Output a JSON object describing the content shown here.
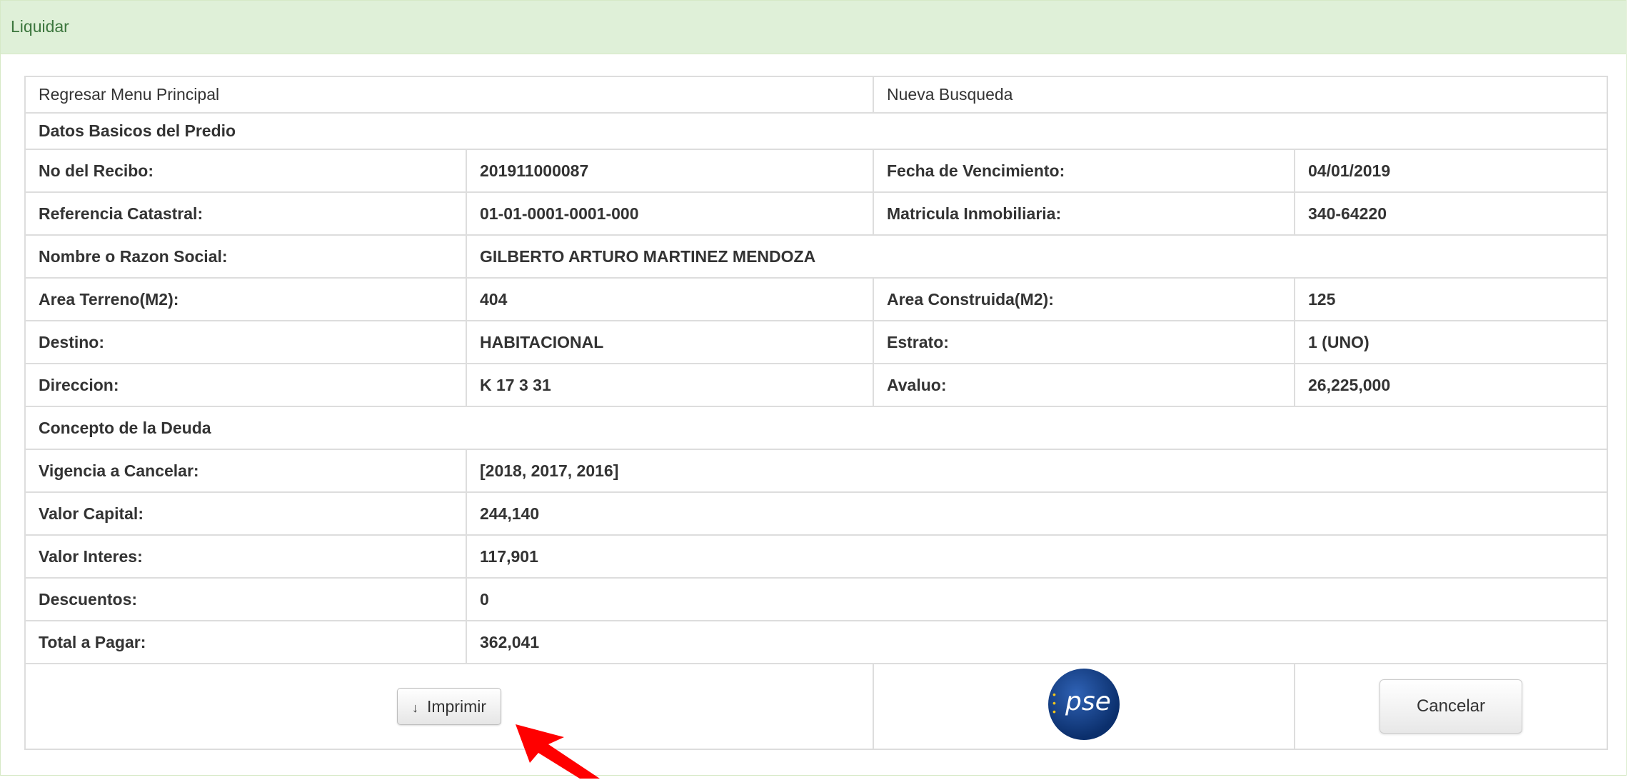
{
  "panel": {
    "title": "Liquidar"
  },
  "nav": {
    "back_label": "Regresar Menu Principal",
    "new_search_label": "Nueva Busqueda"
  },
  "basic": {
    "section_title": "Datos Basicos del Predio",
    "recibo_label": "No del Recibo:",
    "recibo_value": "201911000087",
    "vencimiento_label": "Fecha de Vencimiento:",
    "vencimiento_value": "04/01/2019",
    "catastral_label": "Referencia Catastral:",
    "catastral_value": "01-01-0001-0001-000",
    "matricula_label": "Matricula Inmobiliaria:",
    "matricula_value": "340-64220",
    "nombre_label": "Nombre o Razon Social:",
    "nombre_value": "GILBERTO ARTURO MARTINEZ MENDOZA",
    "area_terreno_label": "Area Terreno(M2):",
    "area_terreno_value": "404",
    "area_construida_label": "Area Construida(M2):",
    "area_construida_value": "125",
    "destino_label": "Destino:",
    "destino_value": "HABITACIONAL",
    "estrato_label": "Estrato:",
    "estrato_value": "1 (UNO)",
    "direccion_label": "Direccion:",
    "direccion_value": "K 17 3 31",
    "avaluo_label": "Avaluo:",
    "avaluo_value": "26,225,000"
  },
  "debt": {
    "section_title": "Concepto de la Deuda",
    "vigencia_label": "Vigencia a Cancelar:",
    "vigencia_value": "[2018, 2017, 2016]",
    "capital_label": "Valor Capital:",
    "capital_value": "244,140",
    "interes_label": "Valor Interes:",
    "interes_value": "117,901",
    "descuentos_label": "Descuentos:",
    "descuentos_value": "0",
    "total_label": "Total a Pagar:",
    "total_value": "362,041"
  },
  "actions": {
    "print_label": "Imprimir",
    "print_icon": "arrow-down-icon",
    "pse_text": "pse",
    "cancel_label": "Cancelar"
  },
  "colors": {
    "heading_bg": "#dff0d8",
    "heading_text": "#3c763d",
    "annotation_arrow": "#ff0000"
  }
}
